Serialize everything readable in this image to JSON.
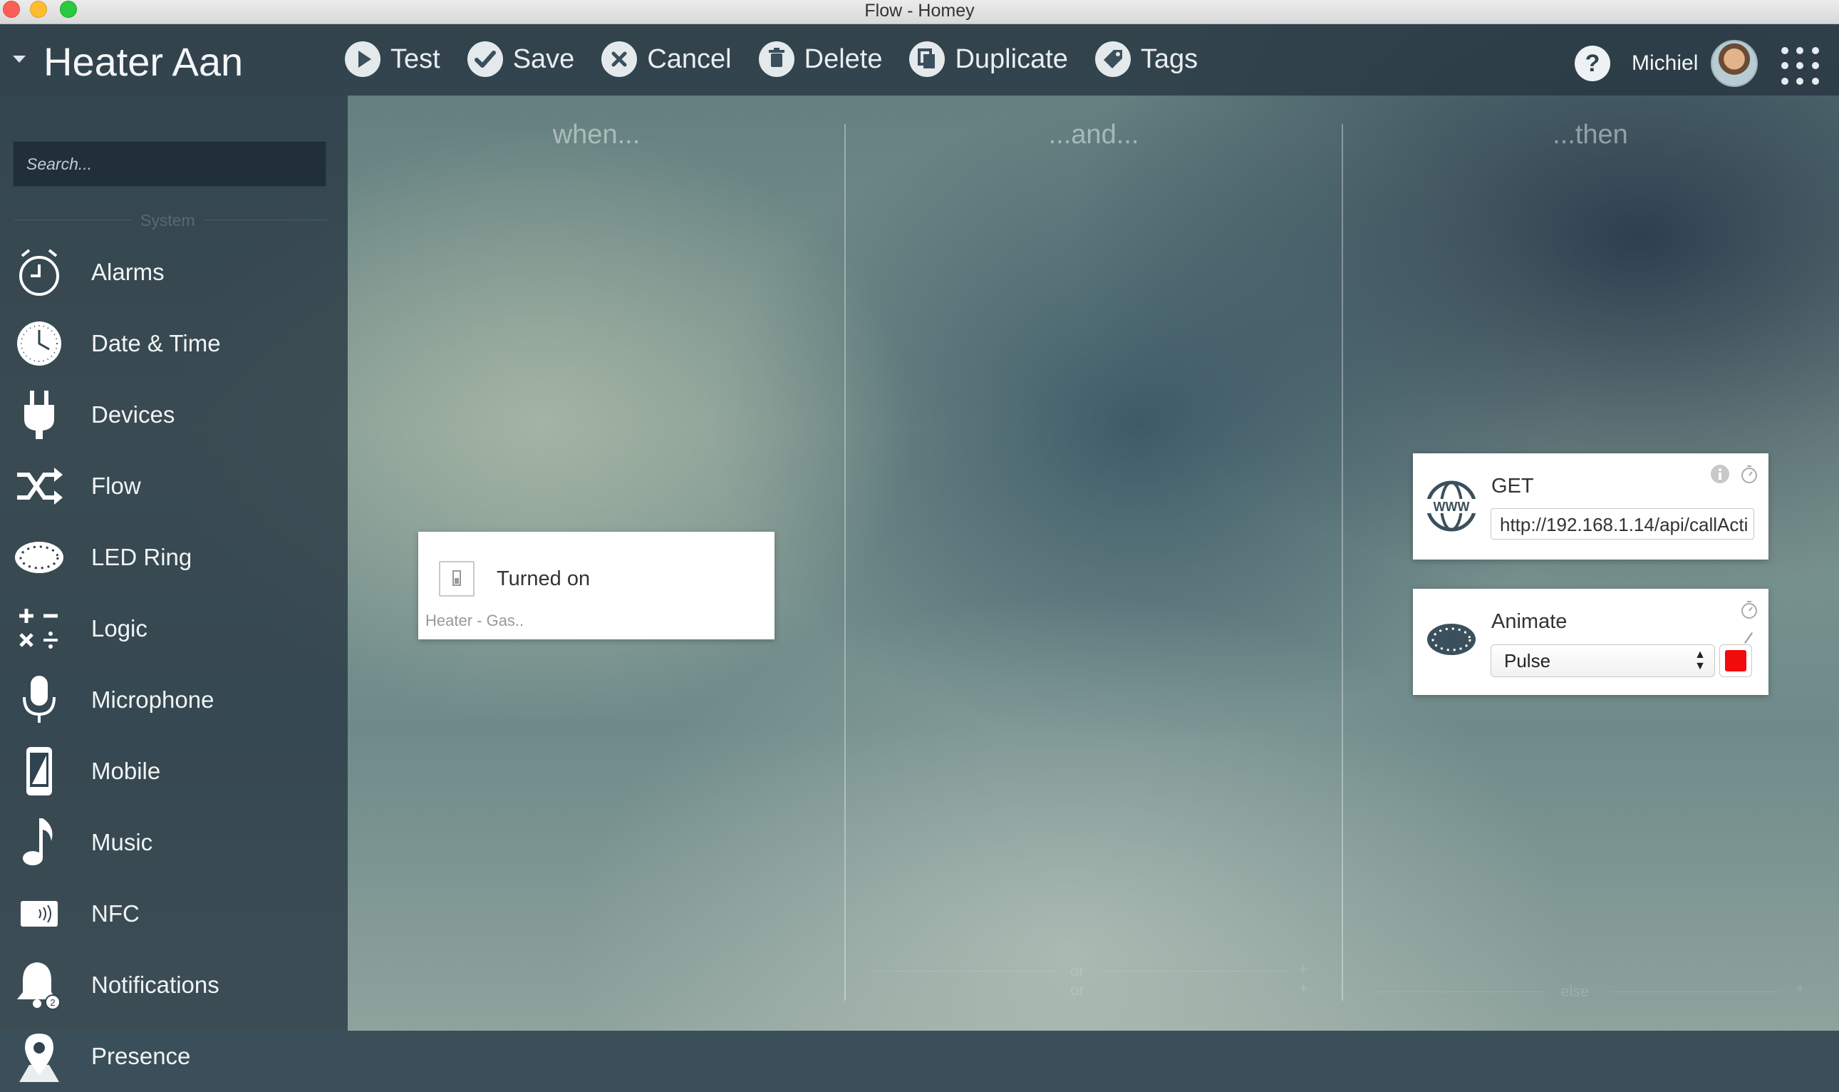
{
  "window": {
    "title": "Flow - Homey"
  },
  "header": {
    "flow_name": "Heater Aan",
    "toolbar": {
      "test": "Test",
      "save": "Save",
      "cancel": "Cancel",
      "delete": "Delete",
      "duplicate": "Duplicate",
      "tags": "Tags"
    },
    "help": "?",
    "user_name": "Michiel"
  },
  "sidebar": {
    "search_placeholder": "Search...",
    "section_label": "System",
    "items": [
      {
        "label": "Alarms",
        "icon": "alarm-clock-icon"
      },
      {
        "label": "Date & Time",
        "icon": "clock-icon"
      },
      {
        "label": "Devices",
        "icon": "plug-icon"
      },
      {
        "label": "Flow",
        "icon": "shuffle-icon"
      },
      {
        "label": "LED Ring",
        "icon": "led-ring-icon"
      },
      {
        "label": "Logic",
        "icon": "math-operators-icon"
      },
      {
        "label": "Microphone",
        "icon": "microphone-icon"
      },
      {
        "label": "Mobile",
        "icon": "smartphone-icon"
      },
      {
        "label": "Music",
        "icon": "music-note-icon"
      },
      {
        "label": "NFC",
        "icon": "nfc-icon"
      },
      {
        "label": "Notifications",
        "icon": "bell-icon"
      },
      {
        "label": "Presence",
        "icon": "location-pin-icon"
      }
    ],
    "notifications_badge": "2"
  },
  "columns": {
    "when": "when...",
    "and": "...and...",
    "then": "...then",
    "or_label": "or",
    "else_label": "else",
    "plus": "+"
  },
  "cards": {
    "trigger": {
      "title": "Turned on",
      "device": "Heater - Gas.."
    },
    "get": {
      "title": "GET",
      "url": "http://192.168.1.14/api/callActi"
    },
    "animate": {
      "title": "Animate",
      "animation": "Pulse",
      "color": "#f20b0b"
    }
  }
}
